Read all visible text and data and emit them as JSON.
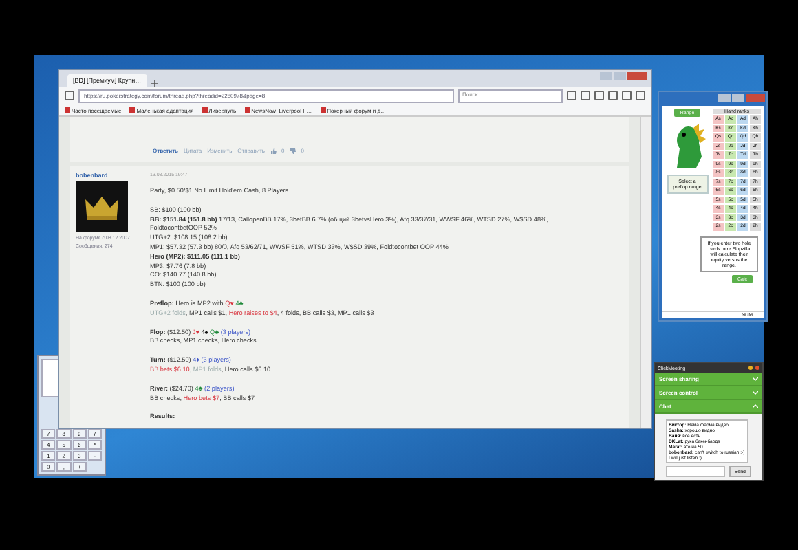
{
  "browser": {
    "tab_title": "[BD] [Премиум] Крупн…",
    "url": "https://ru.pokerstrategy.com/forum/thread.php?threadid=2280978&page=8",
    "search_placeholder": "Поиск",
    "bookmarks": [
      "Часто посещаемые",
      "Маленькая адаптация",
      "Ливерпуль",
      "NewsNow: Liverpool F…",
      "Покерный форум и д…"
    ],
    "post_actions": [
      "Ответить",
      "Цитата",
      "Изменить",
      "Отправить"
    ],
    "likes": "0",
    "dislikes": "0",
    "post": {
      "author": "bobenbard",
      "author_meta": "На форуме с 08.12.2007",
      "author_posts": "Сообщения: 274",
      "date": "13.08.2015 19:47",
      "paragraphs": [
        [
          [
            {
              "text": "Party, $0.50/$1 No Limit Hold'em Cash, 8 Players",
              "kind": "plain"
            }
          ]
        ],
        [
          [
            {
              "text": "SB: $100 (100 bb)",
              "kind": "plain"
            }
          ],
          [
            {
              "text": "BB: $151.84 (151.8 bb)",
              "kind": "bold"
            },
            {
              "text": " 17/13, CallopenBB 17%, 3betBB 6.7% (общий 3betvsHero 3%), Afq 33/37/31, WWSF 46%, WTSD 27%, W$SD 48%,",
              "kind": "plain"
            }
          ],
          [
            {
              "text": "FoldtocontbetOOP 52%",
              "kind": "plain"
            }
          ],
          [
            {
              "text": "UTG+2: $108.15 (108.2 bb)",
              "kind": "plain"
            }
          ],
          [
            {
              "text": "MP1: $57.32 (57.3 bb) 80/0, Afq 53/62/71, WWSF 51%, WTSD 33%, W$SD 39%, Foldtocontbet OOP 44%",
              "kind": "plain"
            }
          ],
          [
            {
              "text": "Hero (MP2): $111.05 (111.1 bb)",
              "kind": "bold"
            }
          ],
          [
            {
              "text": "MP3: $7.76 (7.8 bb)",
              "kind": "plain"
            }
          ],
          [
            {
              "text": "CO: $140.77 (140.8 bb)",
              "kind": "plain"
            }
          ],
          [
            {
              "text": "BTN: $100 (100 bb)",
              "kind": "plain"
            }
          ]
        ],
        [
          [
            {
              "text": "Preflop:",
              "kind": "bold"
            },
            {
              "text": " Hero is MP2 with ",
              "kind": "plain"
            },
            {
              "text": "Q♥",
              "kind": "red"
            },
            {
              "text": " 4♣",
              "kind": "green"
            }
          ],
          [
            {
              "text": "UTG+2 folds",
              "kind": "grey"
            },
            {
              "text": ", MP1 calls $1, ",
              "kind": "plain"
            },
            {
              "text": "Hero raises to $4",
              "kind": "red"
            },
            {
              "text": ", 4 folds, BB calls $3, MP1 calls $3",
              "kind": "plain"
            }
          ]
        ],
        [
          [
            {
              "text": "Flop:",
              "kind": "bold"
            },
            {
              "text": " ($12.50) ",
              "kind": "plain"
            },
            {
              "text": "J♥",
              "kind": "red"
            },
            {
              "text": " 4♠",
              "kind": "dark"
            },
            {
              "text": " Q♣",
              "kind": "green"
            },
            {
              "text": " (3 players)",
              "kind": "blue"
            }
          ],
          [
            {
              "text": "BB checks, MP1 checks, Hero checks",
              "kind": "plain"
            }
          ]
        ],
        [
          [
            {
              "text": "Turn:",
              "kind": "bold"
            },
            {
              "text": " ($12.50) ",
              "kind": "plain"
            },
            {
              "text": "4♦",
              "kind": "blue"
            },
            {
              "text": " (3 players)",
              "kind": "blue"
            }
          ],
          [
            {
              "text": "BB bets $6.10",
              "kind": "red"
            },
            {
              "text": ", MP1 folds",
              "kind": "grey"
            },
            {
              "text": ", Hero calls $6.10",
              "kind": "plain"
            }
          ]
        ],
        [
          [
            {
              "text": "River:",
              "kind": "bold"
            },
            {
              "text": " ($24.70) ",
              "kind": "plain"
            },
            {
              "text": "4♣",
              "kind": "green"
            },
            {
              "text": " (2 players)",
              "kind": "blue"
            }
          ],
          [
            {
              "text": "BB checks, ",
              "kind": "plain"
            },
            {
              "text": "Hero bets $7",
              "kind": "red"
            },
            {
              "text": ", BB calls $7",
              "kind": "plain"
            }
          ]
        ],
        [
          [
            {
              "text": "Results:",
              "kind": "bold"
            }
          ]
        ]
      ]
    }
  },
  "range_tool": {
    "range_button": "Range",
    "hint": "Select a preflop range",
    "grid_title": "Hand ranks",
    "grid": [
      [
        "As",
        "Ac",
        "Ad",
        "Ah"
      ],
      [
        "Ks",
        "Kc",
        "Kd",
        "Kh"
      ],
      [
        "Qs",
        "Qc",
        "Qd",
        "Qh"
      ],
      [
        "Js",
        "Jc",
        "Jd",
        "Jh"
      ],
      [
        "Ts",
        "Tc",
        "Td",
        "Th"
      ],
      [
        "9s",
        "9c",
        "9d",
        "9h"
      ],
      [
        "8s",
        "8c",
        "8d",
        "8h"
      ],
      [
        "7s",
        "7c",
        "7d",
        "7h"
      ],
      [
        "6s",
        "6c",
        "6d",
        "6h"
      ],
      [
        "5s",
        "5c",
        "5d",
        "5h"
      ],
      [
        "4s",
        "4c",
        "4d",
        "4h"
      ],
      [
        "3s",
        "3c",
        "3d",
        "3h"
      ],
      [
        "2s",
        "2c",
        "2d",
        "2h"
      ]
    ],
    "info": "If you enter two hole cards here Flopzilla will calculate their equity versus the range.",
    "calc_button": "Calc",
    "status": "NUM"
  },
  "meeting": {
    "title": "ClickMeeting",
    "sections": [
      {
        "label": "Screen sharing",
        "expanded": false
      },
      {
        "label": "Screen control",
        "expanded": false
      },
      {
        "label": "Chat",
        "expanded": true
      }
    ],
    "chat": [
      {
        "author": "Виктор:",
        "text": " Нема фарма видео"
      },
      {
        "author": "Sasha:",
        "text": " хорошо видно"
      },
      {
        "author": "Ваня:",
        "text": " все есть"
      },
      {
        "author": "DKLat:",
        "text": " рука бакенбарда"
      },
      {
        "author": "Marat:",
        "text": " это на 50"
      },
      {
        "author": "bobenbard:",
        "text": " can't switch to russian :-) I will just listen :)"
      }
    ],
    "send_button": "Send"
  },
  "calculator": {
    "keys": [
      "7",
      "8",
      "9",
      "/",
      "4",
      "5",
      "6",
      "*",
      "1",
      "2",
      "3",
      "-",
      "0",
      ",",
      "+"
    ]
  }
}
